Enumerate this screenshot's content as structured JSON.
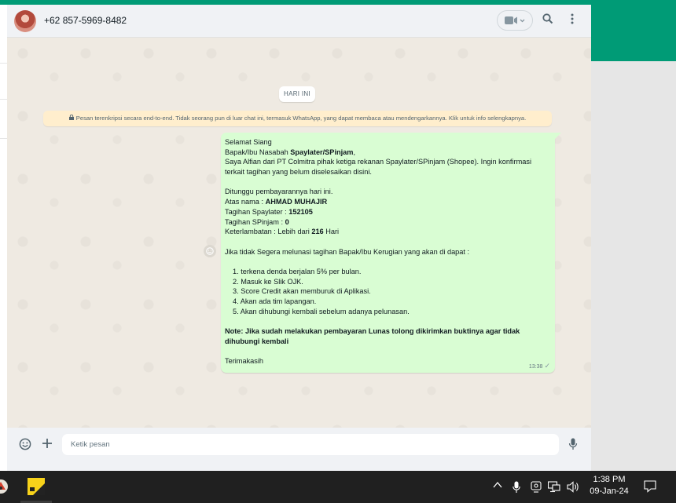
{
  "header": {
    "contact_name": "+62 857-5969-8482"
  },
  "chat": {
    "date_chip": "HARI INI",
    "encryption_notice": "Pesan terenkripsi secara end-to-end. Tidak seorang pun di luar chat ini, termasuk WhatsApp, yang dapat membaca atau mendengarkannya. Klik untuk info selengkapnya.",
    "message": {
      "greeting": "Selamat Siang",
      "line2_a": "Bapak/Ibu Nasabah ",
      "line2_b": "Spaylater/SPinjam",
      "line2_c": ",",
      "line3": "Saya Alfian dari PT Colmitra pihak ketiga rekanan Spaylater/SPinjam (Shopee). Ingin konfirmasi",
      "line4": "terkait tagihan yang belum diselesaikan disini.",
      "line5": "Ditunggu pembayarannya hari ini.",
      "name_label": "Atas nama : ",
      "name_value": "AHMAD MUHAJIR",
      "spaylater_label": "Tagihan Spaylater : ",
      "spaylater_value": "152105",
      "spinjam_label": "Tagihan SPinjam : ",
      "spinjam_value": "0",
      "late_label": "Keterlambatan :  Lebih dari ",
      "late_value": "216",
      "late_unit": " Hari",
      "warning": "Jika tidak Segera melunasi tagihan Bapak/Ibu Kerugian yang akan di dapat :",
      "consequences": [
        "1. terkena denda berjalan 5% per bulan.",
        "2. Masuk ke Slik OJK.",
        "3. Score Credit akan memburuk di Aplikasi.",
        "4. Akan ada tim lapangan.",
        "5. Akan dihubungi kembali sebelum adanya pelunasan."
      ],
      "note_line1": "Note: Jika sudah melakukan pembayaran Lunas tolong dikirimkan buktinya agar tidak",
      "note_line2": "dihubungi kembali",
      "closing": "Terimakasih",
      "time": "13:38"
    }
  },
  "composer": {
    "placeholder": "Ketik pesan"
  },
  "taskbar": {
    "time": "1:38 PM",
    "date": "09-Jan-24"
  },
  "colors": {
    "brand_teal": "#009b76",
    "bubble_green": "#d9fdd3",
    "notice_yellow": "#ffeecd"
  },
  "icons": [
    "video-camera-icon",
    "chevron-down-icon",
    "search-icon",
    "menu-dots-icon",
    "lock-icon",
    "emoji-icon",
    "plus-icon",
    "microphone-icon",
    "check-icon"
  ]
}
